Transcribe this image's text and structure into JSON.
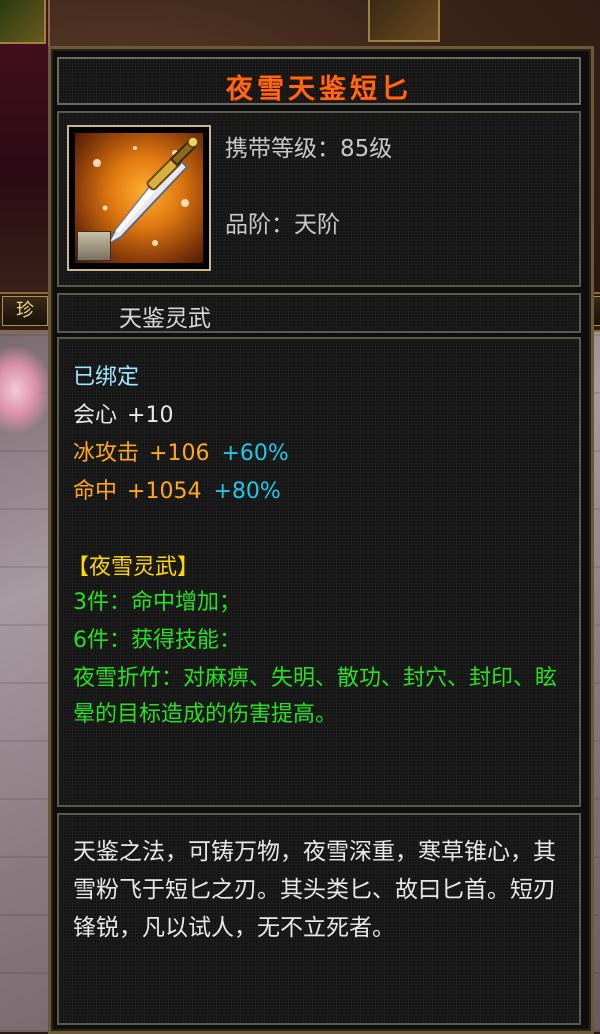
{
  "background": {
    "tab_left_label": "珍",
    "colors": {
      "frame": "#6a5a3a",
      "panel": "#151515"
    }
  },
  "tooltip": {
    "item_name": "夜雪天鉴短匕",
    "item_icon": "dagger-icon",
    "carry_level": "携带等级：85级",
    "grade": "品阶：天阶",
    "set_name": "天鉴灵武",
    "bound": "已绑定",
    "stats": [
      {
        "name": "会心",
        "value": "+10",
        "percent": ""
      },
      {
        "name": "冰攻击",
        "value": "+106",
        "percent": "+60%"
      },
      {
        "name": "命中",
        "value": "+1054",
        "percent": "+80%"
      }
    ],
    "set_title": "【夜雪灵武】",
    "set_effects": [
      "3件：命中增加；",
      "6件：获得技能：",
      "夜雪折竹：对麻痹、失明、散功、封穴、封印、眩晕的目标造成的伤害提高。"
    ],
    "description": "天鉴之法，可铸万物，夜雪深重，寒草锥心，其雪粉飞于短匕之刃。其头类匕、故曰匕首。短刃锋锐，凡以试人，无不立死者。",
    "colors": {
      "title": "#ff6a10",
      "bound": "#a0e8ff",
      "stat_crit": "#e8e8e8",
      "stat_named": "#ffa818",
      "percent": "#20c8e8",
      "set_title": "#ffd800",
      "set_effect": "#28e020"
    }
  }
}
